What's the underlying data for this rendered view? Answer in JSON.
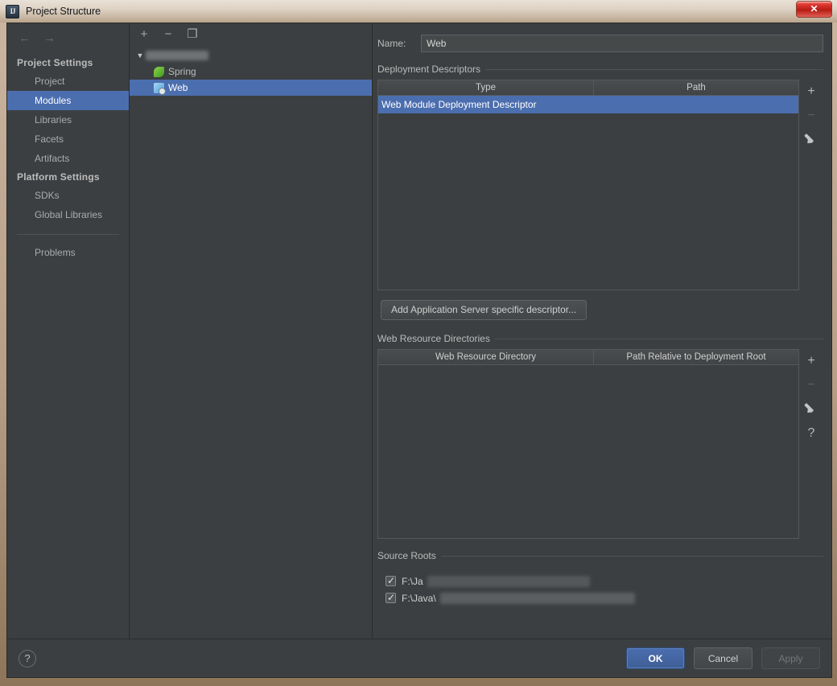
{
  "window": {
    "title": "Project Structure",
    "app_icon": "intellij-idea-icon",
    "close_label": "✕"
  },
  "sidebar": {
    "back_icon": "←",
    "forward_icon": "→",
    "groups": [
      {
        "title": "Project Settings",
        "items": [
          {
            "label": "Project",
            "selected": false
          },
          {
            "label": "Modules",
            "selected": true
          },
          {
            "label": "Libraries",
            "selected": false
          },
          {
            "label": "Facets",
            "selected": false
          },
          {
            "label": "Artifacts",
            "selected": false
          }
        ]
      },
      {
        "title": "Platform Settings",
        "items": [
          {
            "label": "SDKs",
            "selected": false
          },
          {
            "label": "Global Libraries",
            "selected": false
          }
        ]
      }
    ],
    "problems_label": "Problems"
  },
  "tree_panel": {
    "toolbar": {
      "add_label": "+",
      "remove_label": "−",
      "copy_label": "❐"
    },
    "root": {
      "toggle": "▼",
      "label": ""
    },
    "nodes": [
      {
        "label": "Spring",
        "icon": "spring-leaf-icon",
        "selected": false
      },
      {
        "label": "Web",
        "icon": "web-module-icon",
        "selected": true
      }
    ]
  },
  "details": {
    "name_label": "Name:",
    "name_value": "Web",
    "deployment_descriptors": {
      "section_title": "Deployment Descriptors",
      "columns": [
        "Type",
        "Path"
      ],
      "rows": [
        {
          "type": "Web Module Deployment Descriptor",
          "path": "",
          "selected": true
        }
      ],
      "rail": {
        "add": "+",
        "remove": "−",
        "edit": "edit-pencil-icon"
      }
    },
    "add_descriptor_button": "Add Application Server specific descriptor...",
    "web_resource_directories": {
      "section_title": "Web Resource Directories",
      "columns": [
        "Web Resource Directory",
        "Path Relative to Deployment Root"
      ],
      "rows": [
        {
          "directory": "",
          "relative_path": "",
          "selected": false
        }
      ],
      "rail": {
        "add": "+",
        "remove": "−",
        "edit": "edit-pencil-icon",
        "help": "?"
      }
    },
    "source_roots": {
      "section_title": "Source Roots",
      "items": [
        {
          "label": "F:\\Ja",
          "checked": true
        },
        {
          "label": "F:\\Java\\",
          "checked": true
        }
      ]
    }
  },
  "bottom_bar": {
    "help_label": "?",
    "ok_label": "OK",
    "cancel_label": "Cancel",
    "apply_label": "Apply"
  },
  "colors": {
    "accent_selection": "#4b6eaf",
    "panel_background": "#3c3f41",
    "border": "#2b2b2b",
    "text_primary": "#bbbbbb",
    "close_red": "#e03a32",
    "frame_tan": "#b79e86"
  }
}
